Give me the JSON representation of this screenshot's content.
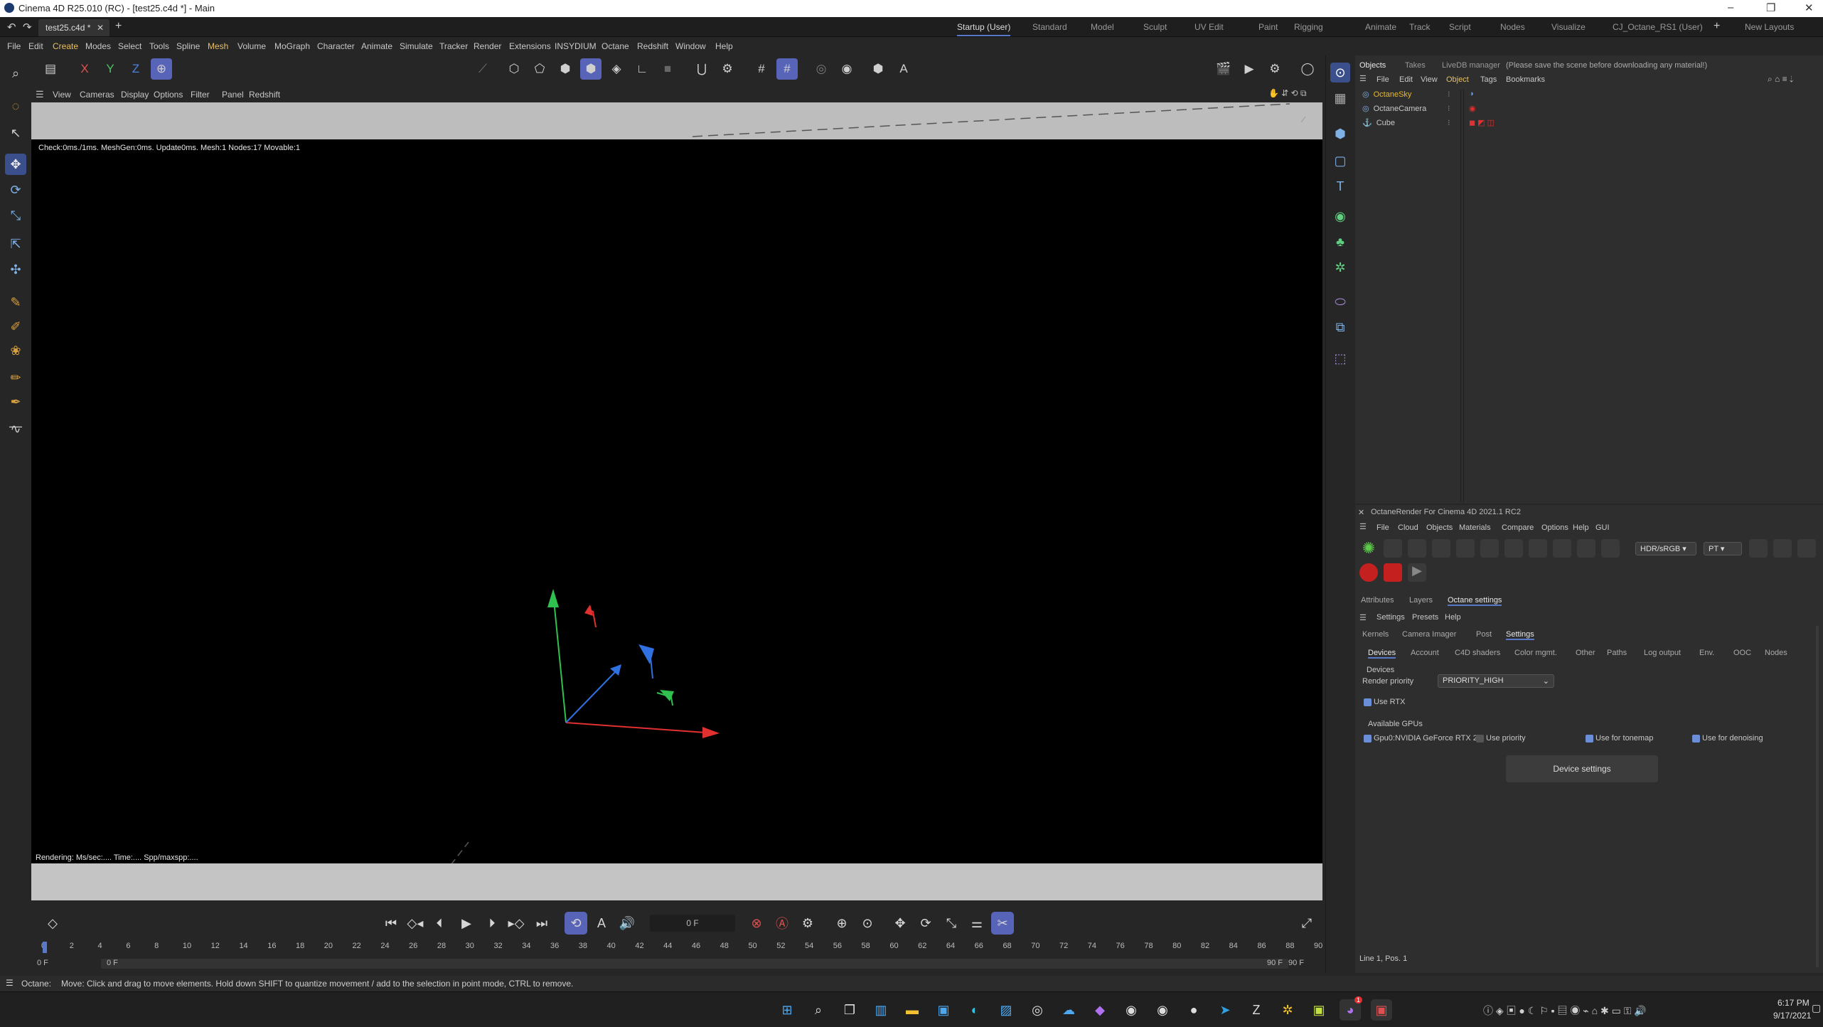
{
  "window": {
    "title": "Cinema 4D R25.010 (RC) - [test25.c4d *] - Main"
  },
  "tabs": {
    "document": "test25.c4d *",
    "layouts": [
      "Startup (User)",
      "Standard",
      "Model",
      "Sculpt",
      "UV Edit",
      "Paint",
      "Rigging",
      "Animate",
      "Track",
      "Script",
      "Nodes",
      "Visualize",
      "CJ_Octane_RS1 (User)"
    ],
    "active_layout": "Startup (User)",
    "new_layouts": "New Layouts"
  },
  "menu": [
    "File",
    "Edit",
    "Create",
    "Modes",
    "Select",
    "Tools",
    "Spline",
    "Mesh",
    "Volume",
    "MoGraph",
    "Character",
    "Animate",
    "Simulate",
    "Tracker",
    "Render",
    "Extensions",
    "INSYDIUM",
    "Octane",
    "Redshift",
    "Window",
    "Help"
  ],
  "toolbar": {
    "axes": [
      "X",
      "Y",
      "Z"
    ],
    "snap_label": "A"
  },
  "viewport": {
    "menu": [
      "View",
      "Cameras",
      "Display",
      "Options",
      "Filter",
      "Panel",
      "Redshift"
    ],
    "stats": "Check:0ms./1ms. MeshGen:0ms. Update0ms. Mesh:1 Nodes:17 Movable:1",
    "render_info": "Rendering: Ms/sec:.... Time:.... Spp/maxspp:...."
  },
  "timeline": {
    "current_frame": "0 F",
    "start_frame": "0 F",
    "start_frame_2": "0 F",
    "end_frame": "90 F",
    "end_frame_2": "90 F",
    "ticks": [
      "0",
      "2",
      "4",
      "6",
      "8",
      "10",
      "12",
      "14",
      "16",
      "18",
      "20",
      "22",
      "24",
      "26",
      "28",
      "30",
      "32",
      "34",
      "36",
      "38",
      "40",
      "42",
      "44",
      "46",
      "48",
      "50",
      "52",
      "54",
      "56",
      "58",
      "60",
      "62",
      "64",
      "66",
      "68",
      "70",
      "72",
      "74",
      "76",
      "78",
      "80",
      "82",
      "84",
      "86",
      "88",
      "90"
    ]
  },
  "status": {
    "prefix": "Octane:",
    "message": "Move: Click and drag to move elements. Hold down SHIFT to quantize movement / add to the selection in point mode, CTRL to remove."
  },
  "objects_panel": {
    "tabs": [
      "Objects",
      "Takes",
      "LiveDB manager"
    ],
    "notice": "(Please save the scene before downloading any material!)",
    "menu": [
      "File",
      "Edit",
      "View",
      "Object",
      "Tags",
      "Bookmarks"
    ],
    "items": [
      {
        "name": "OctaneSky",
        "color": "#e8b830"
      },
      {
        "name": "OctaneCamera",
        "color": "#c8c8c8"
      },
      {
        "name": "Cube",
        "color": "#c8c8c8"
      }
    ],
    "status": "Line 1, Pos. 1"
  },
  "octane_panel": {
    "title": "OctaneRender For Cinema 4D 2021.1 RC2",
    "menu": [
      "File",
      "Cloud",
      "Objects",
      "Materials",
      "Compare",
      "Options",
      "Help",
      "GUI"
    ],
    "color_mode": "HDR/sRGB",
    "kernel": "PT",
    "attr_tabs": [
      "Attributes",
      "Layers",
      "Octane settings"
    ],
    "settings_menu": [
      "Settings",
      "Presets",
      "Help"
    ],
    "main_tabs": [
      "Kernels",
      "Camera Imager",
      "Post",
      "Settings"
    ],
    "sub_tabs": [
      "Devices",
      "Account",
      "C4D shaders",
      "Color mgmt.",
      "Other",
      "Paths",
      "Log output",
      "Env.",
      "OOC",
      "Nodes"
    ],
    "devices_heading": "Devices",
    "render_priority_label": "Render priority",
    "render_priority_value": "PRIORITY_HIGH",
    "use_rtx": "Use RTX",
    "available_gpus": "Available GPUs",
    "gpu_name": "Gpu0:NVIDIA GeForce RTX 2",
    "use_priority": "Use priority",
    "use_tonemap": "Use for tonemap",
    "use_denoising": "Use for denoising",
    "device_settings": "Device settings"
  },
  "taskbar": {
    "time": "6:17 PM",
    "date": "9/17/2021",
    "badge": "1"
  },
  "colors": {
    "accent": "#5864b8",
    "axis_x": "#e03030",
    "axis_y": "#30c050",
    "axis_z": "#3070e0"
  }
}
